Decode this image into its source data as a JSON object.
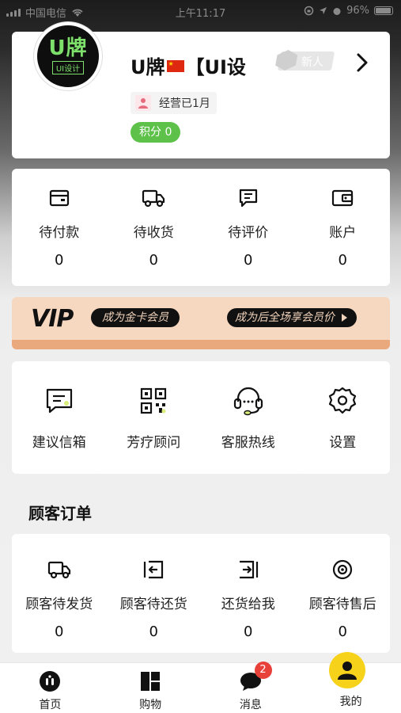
{
  "status_bar": {
    "carrier": "中国电信",
    "time": "上午11:17",
    "battery": "96%"
  },
  "profile": {
    "logo_main": "U牌",
    "logo_sub": "UI设计",
    "name_prefix": "U牌",
    "name_suffix": "【UI设",
    "badge": "新人",
    "tenure": "经营已1月",
    "points": "积分 0"
  },
  "orders": [
    {
      "label": "待付款",
      "count": "0",
      "icon": "wallet-icon"
    },
    {
      "label": "待收货",
      "count": "0",
      "icon": "truck-icon"
    },
    {
      "label": "待评价",
      "count": "0",
      "icon": "comment-icon"
    },
    {
      "label": "账户",
      "count": "0",
      "icon": "account-icon"
    }
  ],
  "vip": {
    "logo": "VIP",
    "join": "成为金卡会员",
    "benefit": "成为后全场享会员价"
  },
  "tools": [
    {
      "label": "建议信箱",
      "icon": "message-icon"
    },
    {
      "label": "芳疗顾问",
      "icon": "qrcode-icon"
    },
    {
      "label": "客服热线",
      "icon": "headset-icon"
    },
    {
      "label": "设置",
      "icon": "gear-icon"
    }
  ],
  "customer_orders": {
    "title": "顾客订单",
    "items": [
      {
        "label": "顾客待发货",
        "count": "0",
        "icon": "truck-icon"
      },
      {
        "label": "顾客待还货",
        "count": "0",
        "icon": "return-icon"
      },
      {
        "label": "还货给我",
        "count": "0",
        "icon": "import-icon"
      },
      {
        "label": "顾客待售后",
        "count": "0",
        "icon": "target-icon"
      }
    ]
  },
  "tabbar": [
    {
      "label": "首页",
      "icon": "home-icon"
    },
    {
      "label": "购物",
      "icon": "shop-icon"
    },
    {
      "label": "消息",
      "icon": "chat-icon",
      "badge": "2"
    },
    {
      "label": "我的",
      "icon": "user-icon"
    }
  ],
  "colors": {
    "accent_green": "#5ec24a",
    "vip_bg": "#f6d7c0",
    "me_yellow": "#f7d21b",
    "badge_red": "#e8413a"
  }
}
